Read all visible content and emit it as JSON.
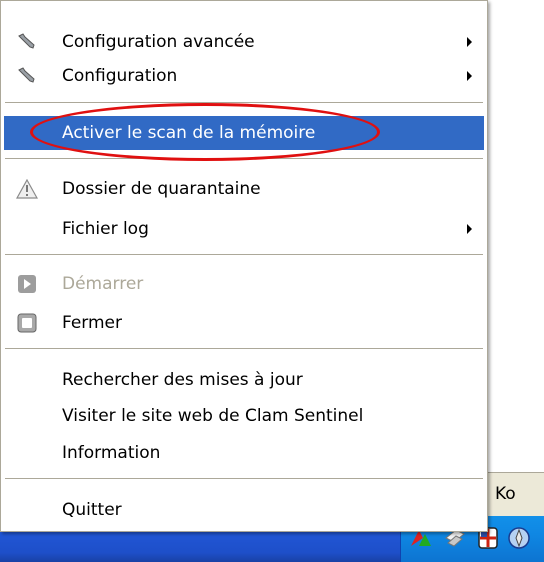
{
  "menu": {
    "items": [
      {
        "label": "Configuration avancée",
        "icon": "wrench-icon",
        "submenu": true
      },
      {
        "label": "Configuration",
        "icon": "wrench-icon",
        "submenu": true
      },
      {
        "label": "Activer le scan de la mémoire",
        "highlighted": true
      },
      {
        "label": "Dossier de quarantaine",
        "icon": "warning-icon"
      },
      {
        "label": "Fichier log",
        "submenu": true
      },
      {
        "label": "Démarrer",
        "icon": "play-icon",
        "disabled": true
      },
      {
        "label": "Fermer",
        "icon": "stop-icon"
      },
      {
        "label": "Rechercher des mises à jour"
      },
      {
        "label": "Visiter le site web de Clam Sentinel"
      },
      {
        "label": "Information"
      },
      {
        "label": "Quitter"
      }
    ],
    "highlight_color": "#316ac5",
    "annotation_color": "#e01010"
  },
  "background": {
    "status_text": "Ko",
    "taskbar_color": "#245edb",
    "tray_icons": [
      "network-icon",
      "sentinel-tray-icon",
      "shield-tray-icon",
      "update-tray-icon"
    ]
  }
}
